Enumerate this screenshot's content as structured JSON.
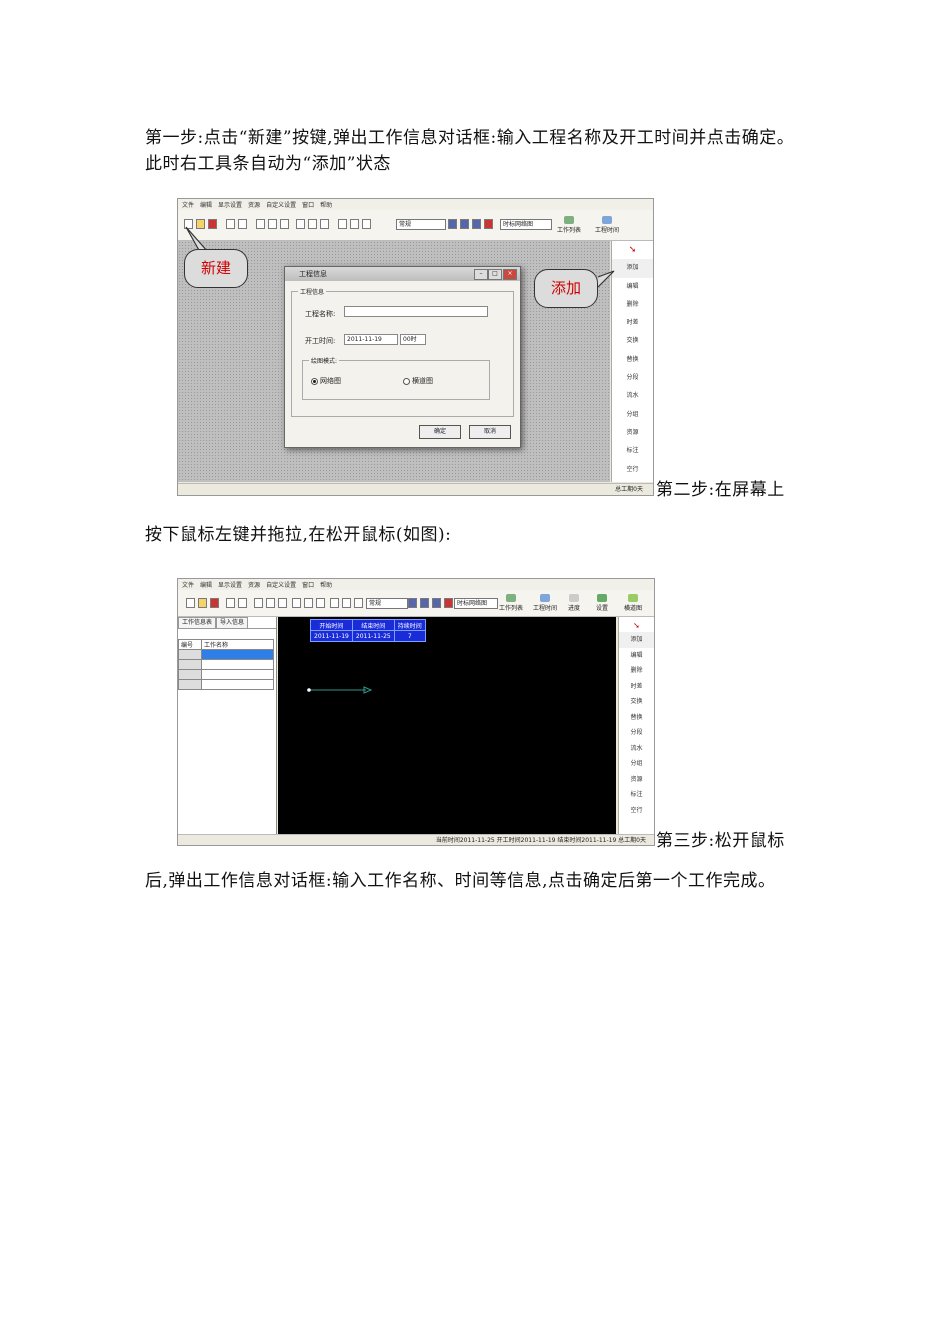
{
  "paragraphs": {
    "step1": "第一步:点击“新建”按键,弹出工作信息对话框:输入工程名称及开工时间并点击确定。此时右工具条自动为“添加”状态",
    "step2_start": "第二步:在屏幕上",
    "step2_rest": "按下鼠标左键并拖拉,在松开鼠标(如图):",
    "step3_start": "第三步:松开鼠标",
    "step3_rest": "后,弹出工作信息对话框:输入工作名称、时间等信息,点击确定后第一个工作完成。"
  },
  "screenshot1": {
    "menu": [
      "文件",
      "编辑",
      "显示设置",
      "资源",
      "自定义设置",
      "窗口",
      "帮助"
    ],
    "view_select": "常规",
    "mode_select": "时标网络图",
    "toolbar_buttons": [
      "工作列表",
      "工程时间"
    ],
    "callout_new": "新建",
    "callout_add": "添加",
    "side_tools": [
      "添加",
      "编辑",
      "删除",
      "时差",
      "交换",
      "替换",
      "分段",
      "流水",
      "分组",
      "资源",
      "标注",
      "空行"
    ],
    "status": "总工期0天",
    "dialog": {
      "title": "工程信息",
      "group": "工程信息",
      "name_label": "工程名称:",
      "name_value": "",
      "date_label": "开工时间:",
      "date_value": "2011-11-19",
      "hour_value": "00时",
      "mode_group": "绘图模式:",
      "mode_network": "网络图",
      "mode_bar": "横道图",
      "ok": "确定",
      "cancel": "取消"
    }
  },
  "screenshot2": {
    "menu": [
      "文件",
      "编辑",
      "显示设置",
      "资源",
      "自定义设置",
      "窗口",
      "帮助"
    ],
    "view_select": "常规",
    "mode_select": "时标网络图",
    "toolbar_buttons": [
      "工作列表",
      "工程时间",
      "进度",
      "设置",
      "横道图"
    ],
    "tabs": [
      "工作信息表",
      "导入信息"
    ],
    "table_headers": [
      "编号",
      "工作名称"
    ],
    "info_headers": [
      "开始时间",
      "结束时间",
      "持续时间"
    ],
    "info_values": [
      "2011-11-19",
      "2011-11-25",
      "7"
    ],
    "side_tools": [
      "添加",
      "编辑",
      "删除",
      "时差",
      "交换",
      "替换",
      "分段",
      "流水",
      "分组",
      "资源",
      "标注",
      "空行"
    ],
    "status": "当前时间2011-11-25  开工时间2011-11-19  结束时间2011-11-19  总工期0天"
  },
  "colors": {
    "callout_text": "#d10000",
    "info_table_bg": "#1a2bd8",
    "canvas_black": "#000000"
  }
}
